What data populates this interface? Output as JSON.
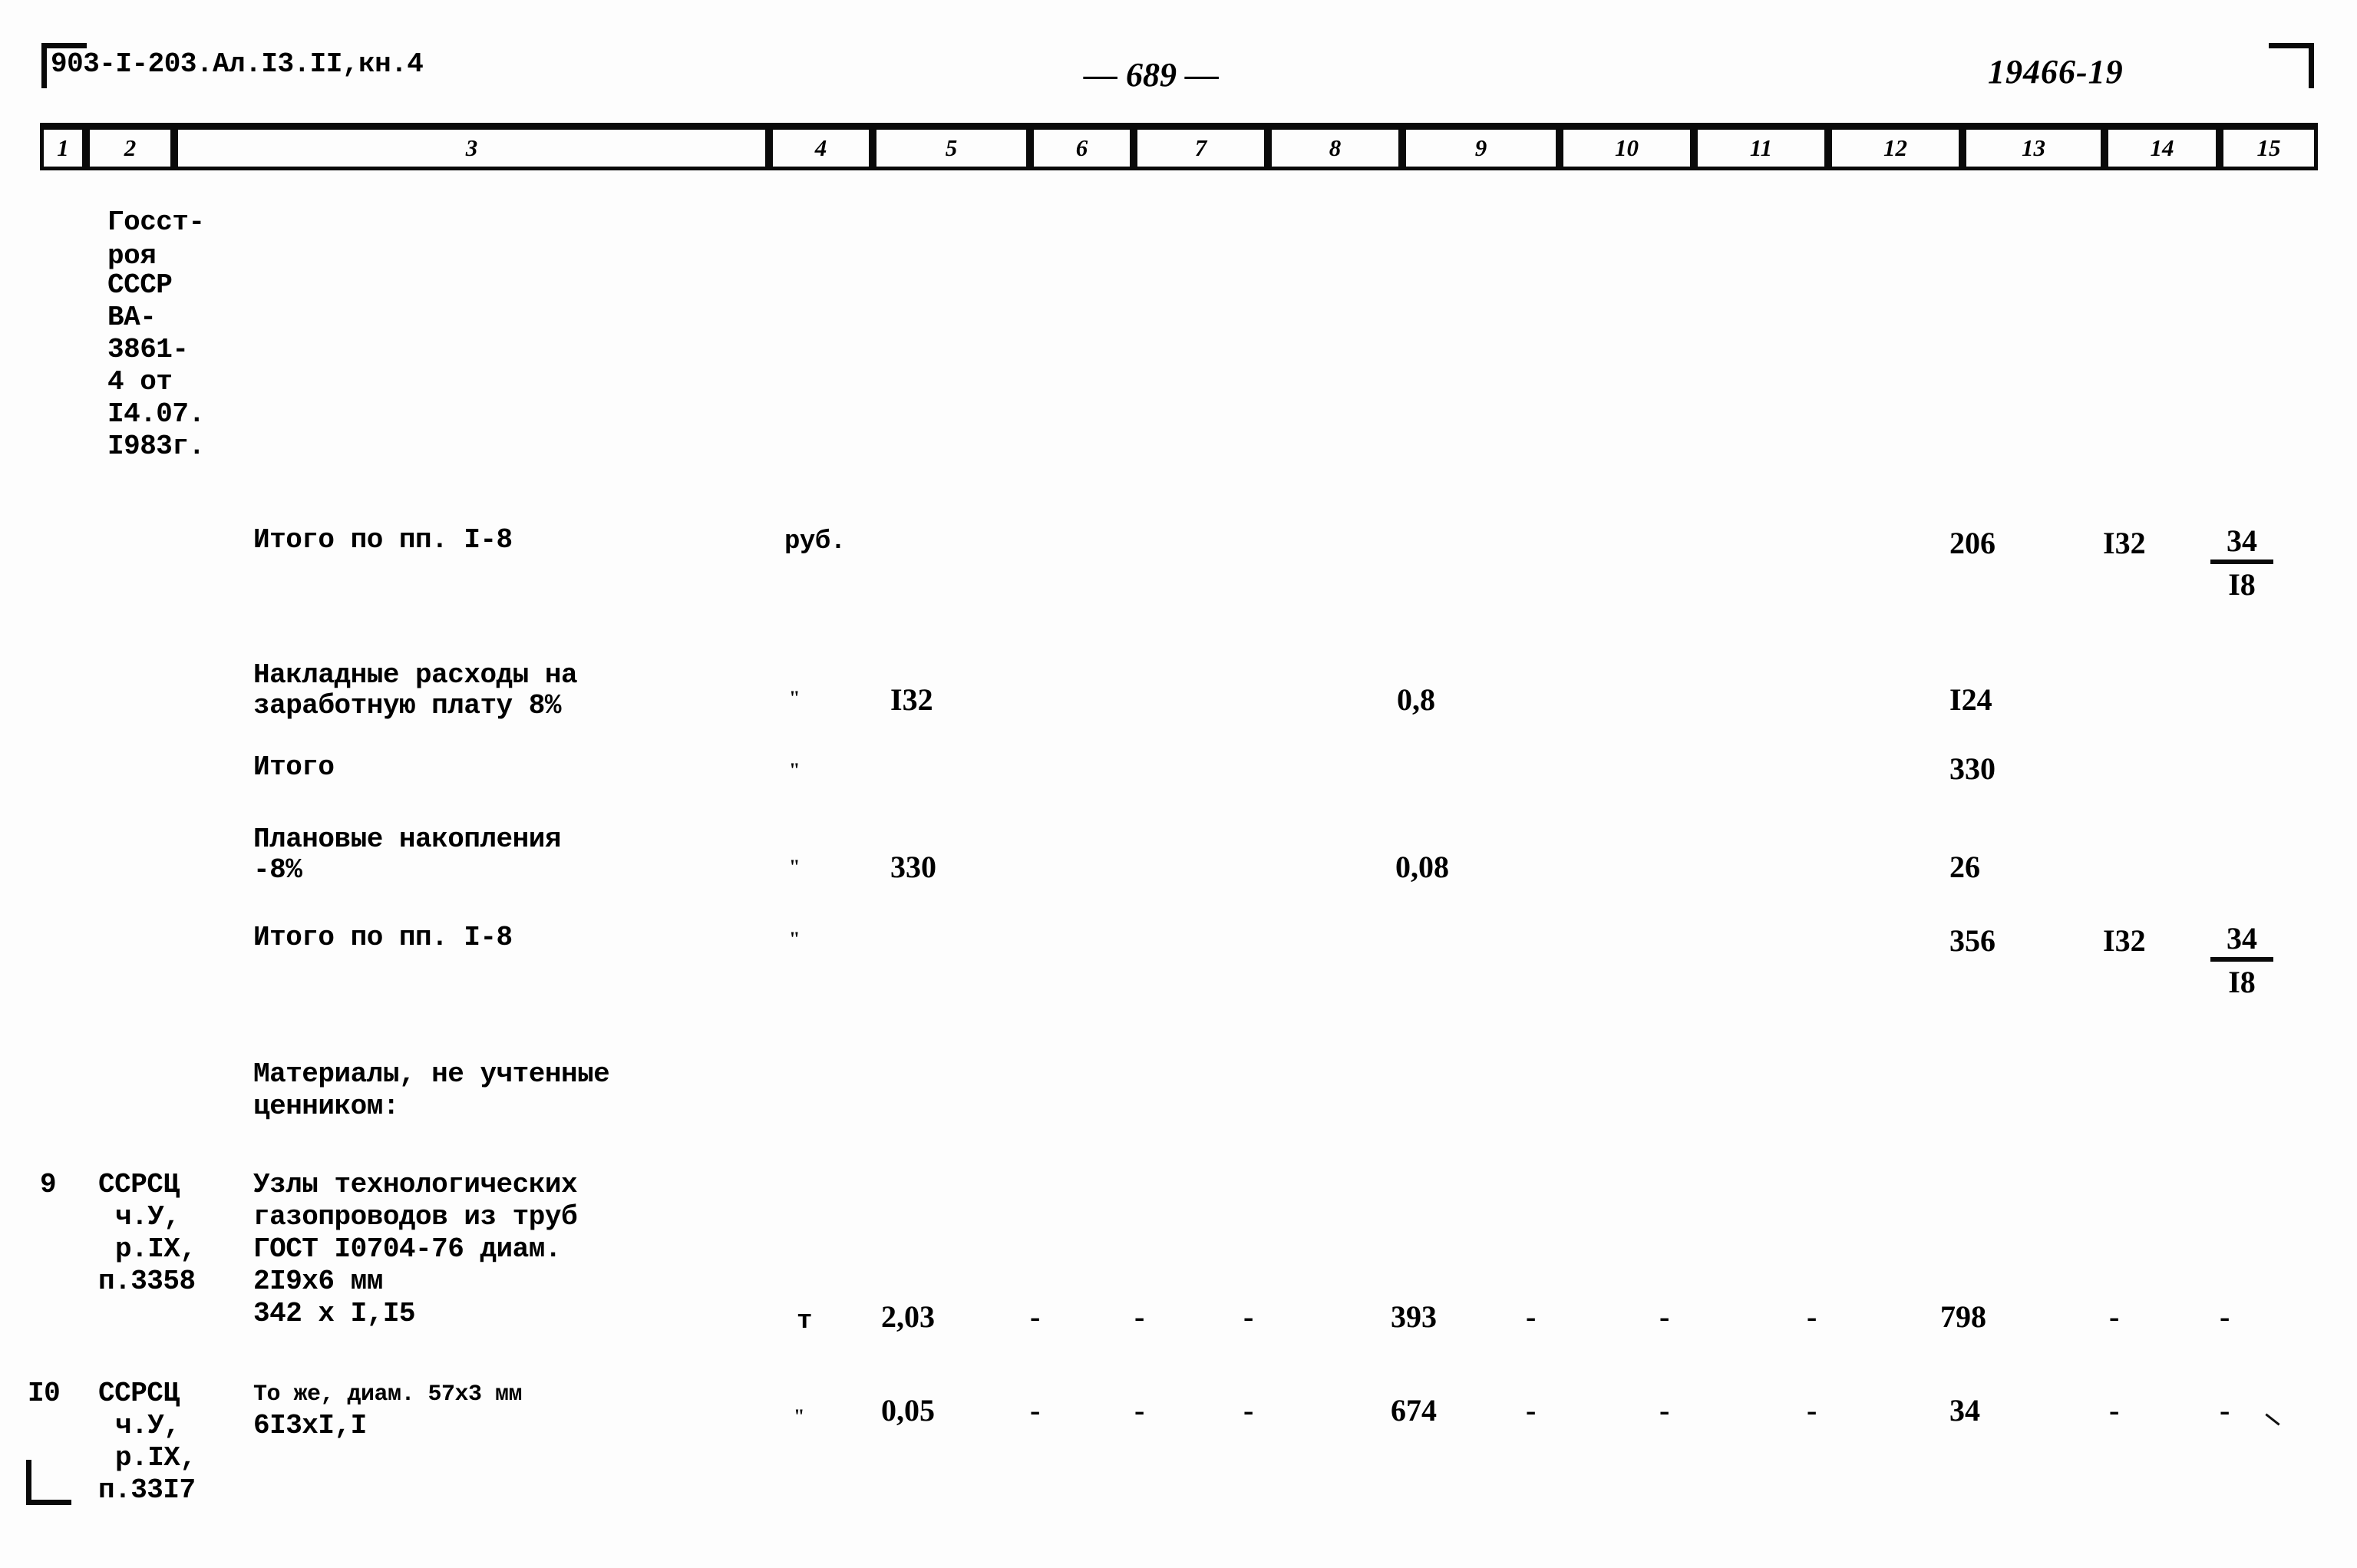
{
  "document": {
    "code": "903-I-203.Ал.I3.II,кн.4",
    "page_number": "— 689 —",
    "stamp": "19466-19"
  },
  "column_headers": [
    "1",
    "2",
    "3",
    "4",
    "5",
    "6",
    "7",
    "8",
    "9",
    "10",
    "11",
    "12",
    "13",
    "14",
    "15"
  ],
  "left_note": {
    "lines": [
      "Госст-",
      "роя",
      "СССР",
      "ВА-",
      "3861-",
      "4 от",
      "I4.07.",
      "I983г."
    ]
  },
  "rows": [
    {
      "name": "total-1-8-first",
      "desc": "Итого по пп. I-8",
      "unit": "руб.",
      "c5": "",
      "c9": "",
      "c13": "206",
      "c14": "I32",
      "c15_top": "34",
      "c15_bot": "I8"
    },
    {
      "name": "overheads",
      "desc_line1": "Накладные расходы на",
      "desc_line2": "заработную плату 8%",
      "unit": "\"",
      "c5": "I32",
      "c9": "0,8",
      "c13": "I24"
    },
    {
      "name": "subtotal",
      "desc": "Итого",
      "unit": "\"",
      "c13": "330"
    },
    {
      "name": "planned-savings",
      "desc_line1": "Плановые накопления",
      "desc_line2": "-8%",
      "unit": "\"",
      "c5": "330",
      "c9": "0,08",
      "c13": "26"
    },
    {
      "name": "total-1-8-second",
      "desc": "Итого по пп. I-8",
      "unit": "\"",
      "c13": "356",
      "c14": "I32",
      "c15_top": "34",
      "c15_bot": "I8"
    }
  ],
  "materials_heading": {
    "line1": "Материалы, не учтенные",
    "line2": "ценником:"
  },
  "items": [
    {
      "no": "9",
      "ref_lines": [
        "ССРСЦ",
        "ч.У,",
        "р.IX,",
        "п.3358"
      ],
      "desc_lines": [
        "Узлы технологических",
        "газопроводов из труб",
        "ГОСТ I0704-76 диам.",
        "2I9x6 мм"
      ],
      "calc_line": "342 x I,I5",
      "unit": "т",
      "c5": "2,03",
      "c6": "-",
      "c7": "-",
      "c8": "-",
      "c9": "393",
      "c10": "-",
      "c11": "-",
      "c12": "-",
      "c13": "798",
      "c14": "-",
      "c15": "-"
    },
    {
      "no": "I0",
      "ref_lines": [
        "ССРСЦ",
        "ч.У,",
        "р.IX,",
        "п.33I7"
      ],
      "desc_lines": [
        "То же, диам. 57x3 мм"
      ],
      "calc_line": "6I3xI,I",
      "unit": "\"",
      "c5": "0,05",
      "c6": "-",
      "c7": "-",
      "c8": "-",
      "c9": "674",
      "c10": "-",
      "c11": "-",
      "c12": "-",
      "c13": "34",
      "c14": "-",
      "c15": "-"
    }
  ]
}
